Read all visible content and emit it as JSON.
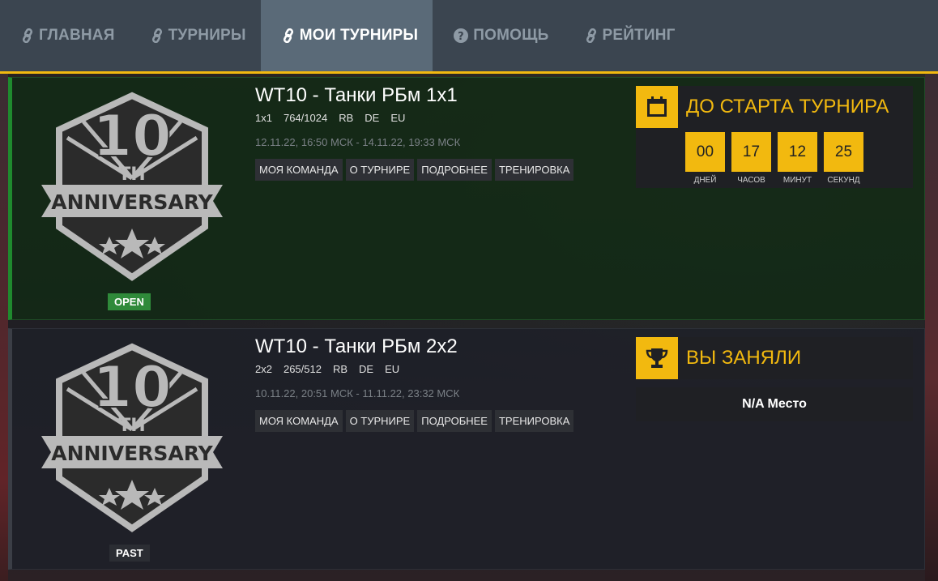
{
  "nav": {
    "items": [
      {
        "label": "ГЛАВНАЯ",
        "icon": "link-icon",
        "active": false
      },
      {
        "label": "ТУРНИРЫ",
        "icon": "link-icon",
        "active": false
      },
      {
        "label": "МОИ ТУРНИРЫ",
        "icon": "link-icon",
        "active": true
      },
      {
        "label": "ПОМОЩЬ",
        "icon": "question-circle-icon",
        "active": false
      },
      {
        "label": "РЕЙТИНГ",
        "icon": "link-icon",
        "active": false
      }
    ]
  },
  "colors": {
    "accent": "#f2b90f",
    "open": "#2f8a3a",
    "nav_bg": "#3b4550"
  },
  "tournaments": [
    {
      "logo_text": "10TH ANNIVERSARY",
      "status": "OPEN",
      "title": "WT10 - Танки РБм 1х1",
      "meta": {
        "format": "1х1",
        "slots": "764/1024",
        "mode": "RB",
        "lang": "DE",
        "region": "EU"
      },
      "dates": "12.11.22, 16:50 МСК - 14.11.22, 19:33 МСК",
      "buttons": [
        "МОЯ КОМАНДА",
        "О ТУРНИРЕ",
        "ПОДРОБНЕЕ",
        "ТРЕНИРОВКА"
      ],
      "panel": {
        "icon": "calendar-icon",
        "title": "ДО СТАРТА ТУРНИРА",
        "countdown": [
          {
            "value": "00",
            "label": "ДНЕЙ"
          },
          {
            "value": "17",
            "label": "ЧАСОВ"
          },
          {
            "value": "12",
            "label": "МИНУТ"
          },
          {
            "value": "25",
            "label": "СЕКУНД"
          }
        ]
      }
    },
    {
      "logo_text": "10TH ANNIVERSARY",
      "status": "PAST",
      "title": "WT10 - Танки РБм 2х2",
      "meta": {
        "format": "2х2",
        "slots": "265/512",
        "mode": "RB",
        "lang": "DE",
        "region": "EU"
      },
      "dates": "10.11.22, 20:51 МСК - 11.11.22, 23:32 МСК",
      "buttons": [
        "МОЯ КОМАНДА",
        "О ТУРНИРЕ",
        "ПОДРОБНЕЕ",
        "ТРЕНИРОВКА"
      ],
      "panel": {
        "icon": "trophy-icon",
        "title": "ВЫ ЗАНЯЛИ",
        "place": "N/A Место"
      }
    }
  ]
}
